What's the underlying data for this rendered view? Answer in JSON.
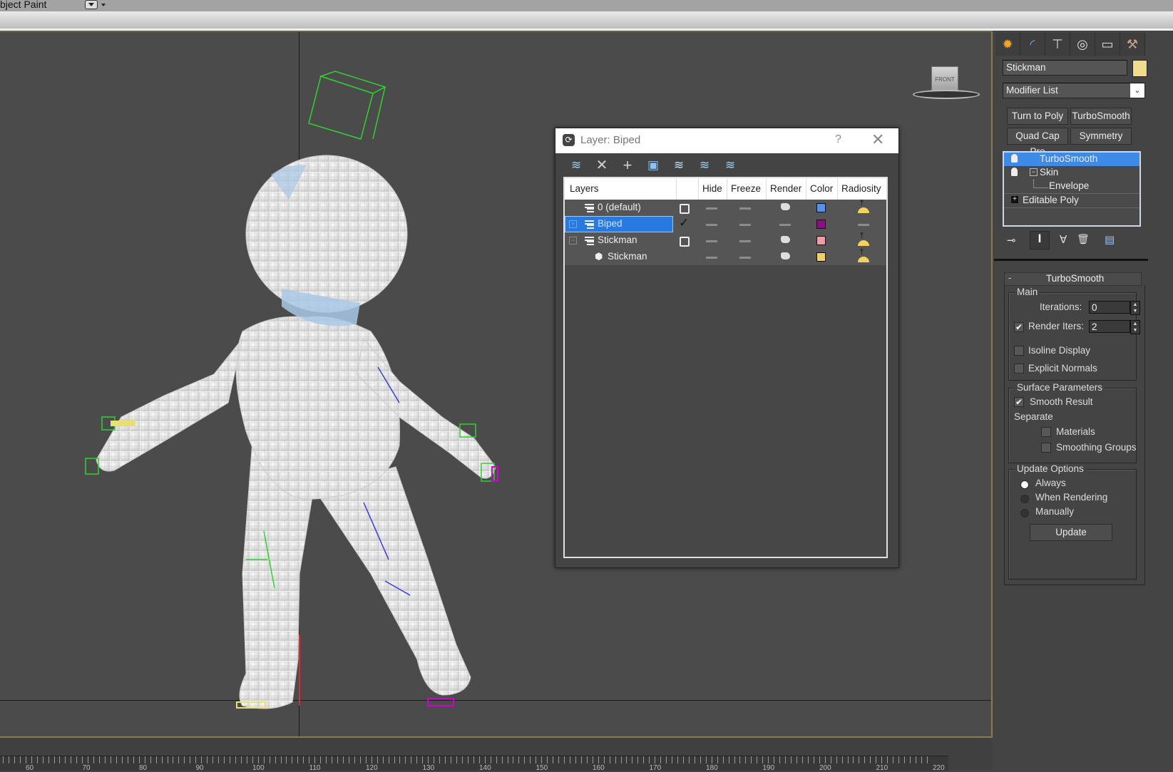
{
  "app": {
    "menu_title": "bject Paint",
    "viewport": {
      "viewcube_label": "FRONT"
    }
  },
  "layer_dialog": {
    "title": "Layer: Biped",
    "help_label": "?",
    "close_label": "✕",
    "toolbar": [
      {
        "name": "create-layer-icon",
        "glyph": "≋"
      },
      {
        "name": "delete-layer-icon",
        "glyph": "✕"
      },
      {
        "name": "add-to-layer-icon",
        "glyph": "+"
      },
      {
        "name": "select-objects-in-layer-icon",
        "glyph": "▣"
      },
      {
        "name": "highlight-selected-layer-icon",
        "glyph": "≋"
      },
      {
        "name": "hide-unhide-all-icon",
        "glyph": "≋"
      },
      {
        "name": "layer-settings-icon",
        "glyph": "≋"
      }
    ],
    "columns": [
      "Layers",
      "Hide",
      "Freeze",
      "Render",
      "Color",
      "Radiosity"
    ],
    "rows": [
      {
        "name": "0 (default)",
        "active": false,
        "render": true,
        "color": "#5b8fe8",
        "radiosity": true,
        "selected": false,
        "type": "layer"
      },
      {
        "name": "Biped",
        "active": true,
        "render": false,
        "color": "#8a0f80",
        "radiosity": false,
        "selected": true,
        "type": "layer"
      },
      {
        "name": "Stickman",
        "active": false,
        "render": true,
        "color": "#e8a0a8",
        "radiosity": true,
        "selected": false,
        "type": "layer"
      },
      {
        "name": "Stickman",
        "active": null,
        "render": true,
        "color": "#f0cf6a",
        "radiosity": true,
        "selected": false,
        "type": "object"
      }
    ]
  },
  "command_panel": {
    "tabs": [
      "create-icon",
      "modify-icon",
      "hierarchy-icon",
      "motion-icon",
      "display-icon",
      "utilities-icon"
    ],
    "object_name": "Stickman",
    "object_color": "#f1dc8d",
    "modifier_list": "Modifier List",
    "quick_buttons": [
      "Turn to Poly",
      "TurboSmooth",
      "Quad Cap Pro",
      "Symmetry"
    ],
    "stack": [
      {
        "label": "TurboSmooth",
        "selected": true
      },
      {
        "label": "Skin",
        "selected": false
      },
      {
        "label": "Envelope",
        "selected": false
      },
      {
        "label": "Editable Poly",
        "selected": false
      }
    ],
    "rollout": {
      "title": "TurboSmooth",
      "collapse": "-",
      "main": {
        "legend": "Main",
        "iterations_label": "Iterations:",
        "iterations": "0",
        "render_iters_label": "Render Iters:",
        "render_iters": "2",
        "render_iters_checked": true,
        "isoline_label": "Isoline Display",
        "isoline_checked": false,
        "explicit_label": "Explicit Normals",
        "explicit_checked": false
      },
      "surface": {
        "legend": "Surface Parameters",
        "smooth_result_label": "Smooth Result",
        "smooth_result_checked": true,
        "separate_label": "Separate",
        "materials_label": "Materials",
        "smoothing_groups_label": "Smoothing Groups"
      },
      "update": {
        "legend": "Update Options",
        "options": [
          "Always",
          "When Rendering",
          "Manually"
        ],
        "selected": "Always",
        "button": "Update"
      }
    }
  },
  "timeline": {
    "labels": [
      "60",
      "70",
      "80",
      "90",
      "100",
      "110",
      "120",
      "130",
      "140",
      "150",
      "160",
      "170",
      "180",
      "190",
      "200",
      "210",
      "220"
    ]
  }
}
